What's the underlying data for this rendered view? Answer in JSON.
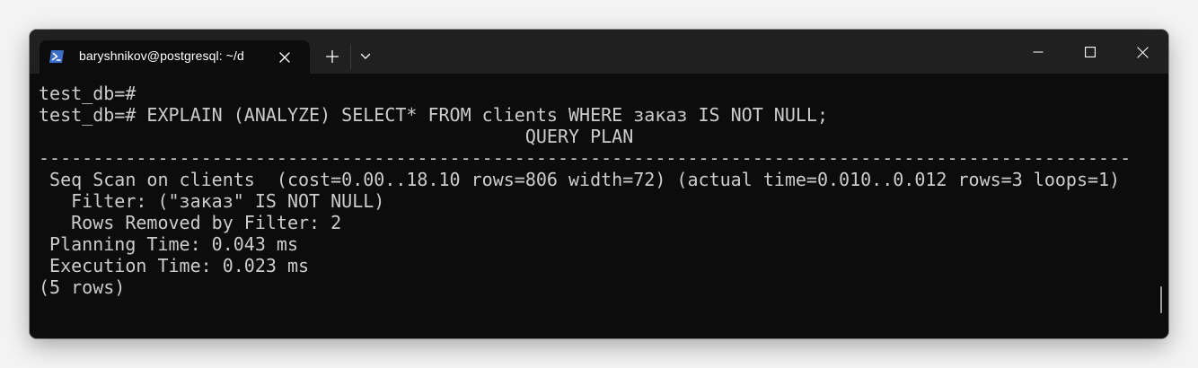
{
  "window": {
    "tab_title": "baryshnikov@postgresql: ~/d",
    "icons": {
      "tab": "powershell-icon",
      "tab_close": "close-icon",
      "new_tab": "plus-icon",
      "dropdown": "chevron-down-icon",
      "minimize": "minimize-icon",
      "maximize": "maximize-icon",
      "close": "close-icon"
    }
  },
  "terminal": {
    "lines": [
      "test_db=#",
      "test_db=# EXPLAIN (ANALYZE) SELECT* FROM clients WHERE заказ IS NOT NULL;",
      "                                             QUERY PLAN",
      "-----------------------------------------------------------------------------------------------------",
      " Seq Scan on clients  (cost=0.00..18.10 rows=806 width=72) (actual time=0.010..0.012 rows=3 loops=1)",
      "   Filter: (\"заказ\" IS NOT NULL)",
      "   Rows Removed by Filter: 2",
      " Planning Time: 0.043 ms",
      " Execution Time: 0.023 ms",
      "(5 rows)"
    ]
  },
  "colors": {
    "terminal_bg": "#0c0c0c",
    "titlebar_bg": "#202020",
    "text": "#cccccc",
    "icon_accent": "#3d6fc9"
  }
}
